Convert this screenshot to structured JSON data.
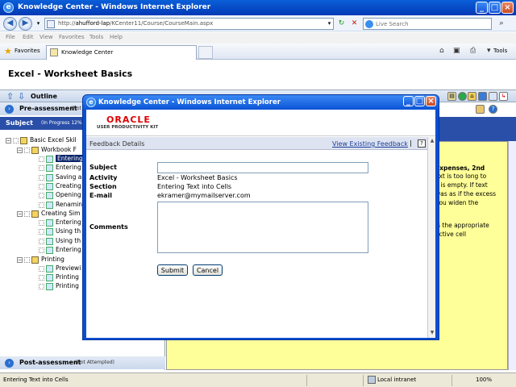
{
  "browser": {
    "title": "Knowledge Center - Windows Internet Explorer",
    "url_prefix": "http://",
    "url_host": "ahufford-lap",
    "url_path": "/KCenter11/Course/CourseMain.aspx",
    "search_placeholder": "Live Search",
    "menu": [
      "File",
      "Edit",
      "View",
      "Favorites",
      "Tools",
      "Help"
    ],
    "favorites_label": "Favorites",
    "tab_label": "Knowledge Center",
    "tools_label": "Tools"
  },
  "page": {
    "title": "Excel - Worksheet Basics",
    "outline_label": "Outline",
    "pre_assessment": {
      "label": "Pre-assessment",
      "status": "(Not"
    },
    "subject": {
      "label": "Subject",
      "status": "(In Progress 12%)"
    },
    "tree": [
      {
        "text": "Basic Excel Skil"
      },
      {
        "text": "Workbook F"
      },
      {
        "text": "Entering"
      },
      {
        "text": "Entering"
      },
      {
        "text": "Saving a"
      },
      {
        "text": "Creating"
      },
      {
        "text": "Opening"
      },
      {
        "text": "Renamin"
      },
      {
        "text": "Creating Sim"
      },
      {
        "text": "Entering"
      },
      {
        "text": "Using th"
      },
      {
        "text": "Using th"
      },
      {
        "text": "Entering"
      },
      {
        "text": "Printing"
      },
      {
        "text": "Previewi"
      },
      {
        "text": "Printing"
      },
      {
        "text": "Printing"
      }
    ],
    "post_assessment": {
      "label": "Post-assessment",
      "status": "(Not Attempted)"
    },
    "yellow_lines": [
      "Expenses, 2nd",
      "ext is too long to",
      "ll is empty. If text",
      "was as if the excess",
      "you widen the",
      "is the appropriate",
      "active cell"
    ]
  },
  "popup": {
    "title": "Knowledge Center - Windows Internet Explorer",
    "brand": "ORACLE",
    "brand_sub": "USER PRODUCTIVITY KIT",
    "header_title": "Feedback Details",
    "view_link": "View Existing Feedback",
    "separator": "|",
    "help_icon": "?",
    "fields": {
      "subject_label": "Subject",
      "subject_value": "",
      "activity_label": "Activity",
      "activity_value": "Excel - Worksheet Basics",
      "section_label": "Section",
      "section_value": "Entering Text into Cells",
      "email_label": "E-mail",
      "email_value": "ekramer@mymailserver.com",
      "comments_label": "Comments",
      "comments_value": ""
    },
    "submit_label": "Submit",
    "cancel_label": "Cancel"
  },
  "statusbar": {
    "text": "Entering Text into Cells",
    "zone": "Local intranet",
    "zoom": "100%"
  }
}
